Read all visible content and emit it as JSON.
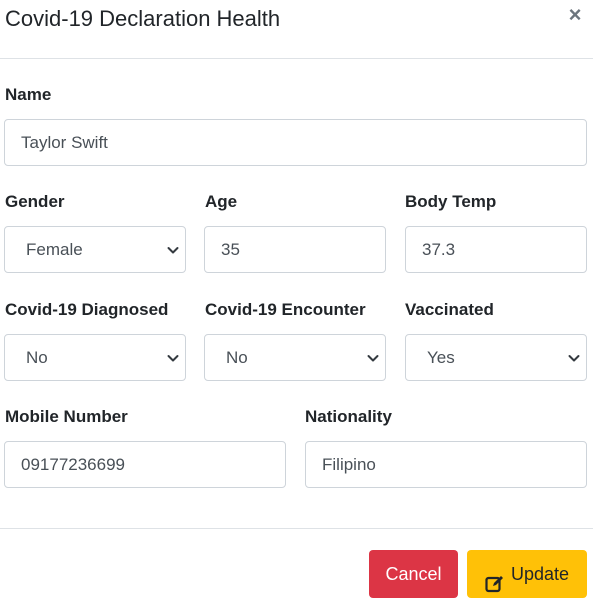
{
  "modal": {
    "title": "Covid-19 Declaration Health",
    "close_symbol": "×"
  },
  "form": {
    "name": {
      "label": "Name",
      "value": "Taylor Swift"
    },
    "gender": {
      "label": "Gender",
      "value": "Female"
    },
    "age": {
      "label": "Age",
      "value": "35"
    },
    "body_temp": {
      "label": "Body Temp",
      "value": "37.3"
    },
    "diagnosed": {
      "label": "Covid-19 Diagnosed",
      "value": "No"
    },
    "encounter": {
      "label": "Covid-19 Encounter",
      "value": "No"
    },
    "vaccinated": {
      "label": "Vaccinated",
      "value": "Yes"
    },
    "mobile": {
      "label": "Mobile Number",
      "value": "09177236699"
    },
    "nationality": {
      "label": "Nationality",
      "value": "Filipino"
    }
  },
  "footer": {
    "cancel_label": "Cancel",
    "update_label": "Update",
    "update_icon": "edit-icon"
  },
  "colors": {
    "cancel": "#dc3545",
    "update": "#ffc107"
  }
}
